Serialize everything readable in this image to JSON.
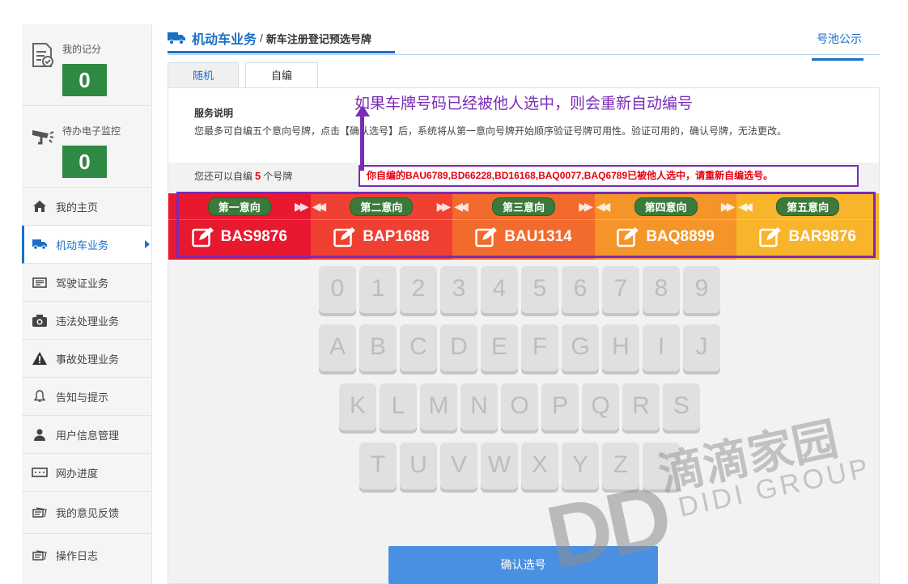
{
  "sidebar": {
    "stats": [
      {
        "label": "我的记分",
        "value": "0",
        "icon": "document-score-icon"
      },
      {
        "label": "待办电子监控",
        "value": "0",
        "icon": "traffic-camera-icon"
      }
    ],
    "items": [
      {
        "label": "我的主页",
        "icon": "home-icon"
      },
      {
        "label": "机动车业务",
        "icon": "truck-icon",
        "active": true
      },
      {
        "label": "驾驶证业务",
        "icon": "license-card-icon"
      },
      {
        "label": "违法处理业务",
        "icon": "camera-icon"
      },
      {
        "label": "事故处理业务",
        "icon": "warning-icon"
      },
      {
        "label": "告知与提示",
        "icon": "bell-icon"
      },
      {
        "label": "用户信息管理",
        "icon": "user-icon"
      },
      {
        "label": "网办进度",
        "icon": "progress-icon"
      },
      {
        "label": "我的意见反馈",
        "icon": "feedback-icon"
      },
      {
        "label": "操作日志",
        "icon": "log-icon"
      }
    ]
  },
  "header": {
    "breadcrumb_main": "机动车业务",
    "breadcrumb_sep": "/",
    "breadcrumb_sub": "新车注册登记预选号牌",
    "pool_link": "号池公示"
  },
  "tabs": [
    {
      "label": "随机"
    },
    {
      "label": "自编",
      "selected": true
    }
  ],
  "service": {
    "title": "服务说明",
    "desc": "您最多可自编五个意向号牌，点击【确认选号】后，系统将从第一意向号牌开始顺序验证号牌可用性。验证可用的，确认号牌，无法更改。"
  },
  "remaining": {
    "prefix": "您还可以自编",
    "count": "5",
    "suffix": "个号牌"
  },
  "error_message": "你自编的BAU6789,BD66228,BD16168,BAQ0077,BAQ6789已被他人选中，请重新自编选号。",
  "annotation": "如果车牌号码已经被他人选中，则会重新自动编号",
  "intentions": [
    {
      "label": "第一意向",
      "plate": "BAS9876",
      "color": "#e8182f"
    },
    {
      "label": "第二意向",
      "plate": "BAP1688",
      "color": "#ef4031"
    },
    {
      "label": "第三意向",
      "plate": "BAU1314",
      "color": "#f26a2c"
    },
    {
      "label": "第四意向",
      "plate": "BAQ8899",
      "color": "#f59428"
    },
    {
      "label": "第五意向",
      "plate": "BAR9876",
      "color": "#f8b42a"
    }
  ],
  "keyboard": {
    "rows": [
      [
        "0",
        "1",
        "2",
        "3",
        "4",
        "5",
        "6",
        "7",
        "8",
        "9"
      ],
      [
        "A",
        "B",
        "C",
        "D",
        "E",
        "F",
        "G",
        "H",
        "I",
        "J"
      ],
      [
        "K",
        "L",
        "M",
        "N",
        "O",
        "P",
        "Q",
        "R",
        "S"
      ],
      [
        "T",
        "U",
        "V",
        "W",
        "X",
        "Y",
        "Z",
        "x"
      ]
    ]
  },
  "confirm_button": "确认选号",
  "watermark": {
    "logo": "DD",
    "cn": "滴滴家园",
    "en": "DIDI GROUP"
  }
}
